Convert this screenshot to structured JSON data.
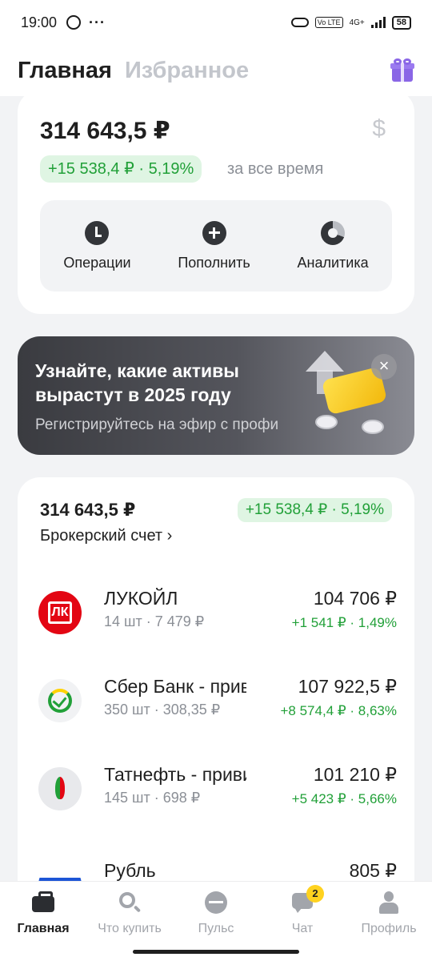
{
  "status_bar": {
    "time": "19:00",
    "dots": "···",
    "network": "4G+",
    "volte": "Vo LTE",
    "battery": "58"
  },
  "header": {
    "tab_main": "Главная",
    "tab_favorites": "Избранное"
  },
  "portfolio": {
    "total": "314 643,5 ₽",
    "gain": "+15 538,4 ₽ · 5,19%",
    "gain_period": "за все время",
    "currency_icon": "$",
    "actions": [
      {
        "label": "Операции",
        "icon": "clock-icon"
      },
      {
        "label": "Пополнить",
        "icon": "plus-icon"
      },
      {
        "label": "Аналитика",
        "icon": "pie-chart-icon"
      }
    ]
  },
  "banner": {
    "title": "Узнайте, какие активы вырастут в 2025 году",
    "subtitle": "Регистрируйтесь на эфир с профи",
    "close": "×"
  },
  "broker": {
    "total": "314 643,5 ₽",
    "gain": "+15 538,4 ₽ · 5,19%",
    "name": "Брокерский счет ›",
    "holdings": [
      {
        "name": "ЛУКОЙЛ",
        "qty": "14 шт · 7 479 ₽",
        "value": "104 706 ₽",
        "change": "+1 541 ₽ · 1,49%",
        "logo_text": "ЛК"
      },
      {
        "name": "Сбер Банк - привилегированные акции",
        "qty": "350 шт · 308,35 ₽",
        "value": "107 922,5 ₽",
        "change": "+8 574,4 ₽ · 8,63%"
      },
      {
        "name": "Татнефть - привилегированные акции",
        "qty": "145 шт · 698 ₽",
        "value": "101 210 ₽",
        "change": "+5 423 ₽ · 5,66%"
      },
      {
        "name": "Рубль",
        "qty": "",
        "value": "805 ₽",
        "change": ""
      }
    ]
  },
  "nav": {
    "items": [
      {
        "label": "Главная",
        "icon": "briefcase-icon",
        "active": true
      },
      {
        "label": "Что купить",
        "icon": "search-icon"
      },
      {
        "label": "Пульс",
        "icon": "pulse-icon"
      },
      {
        "label": "Чат",
        "icon": "chat-icon",
        "badge": "2"
      },
      {
        "label": "Профиль",
        "icon": "person-icon"
      }
    ]
  },
  "colors": {
    "accent_green": "#21a038",
    "gain_bg": "#dff5e3",
    "gift": "#8a66e6",
    "brand_red": "#e30613"
  }
}
